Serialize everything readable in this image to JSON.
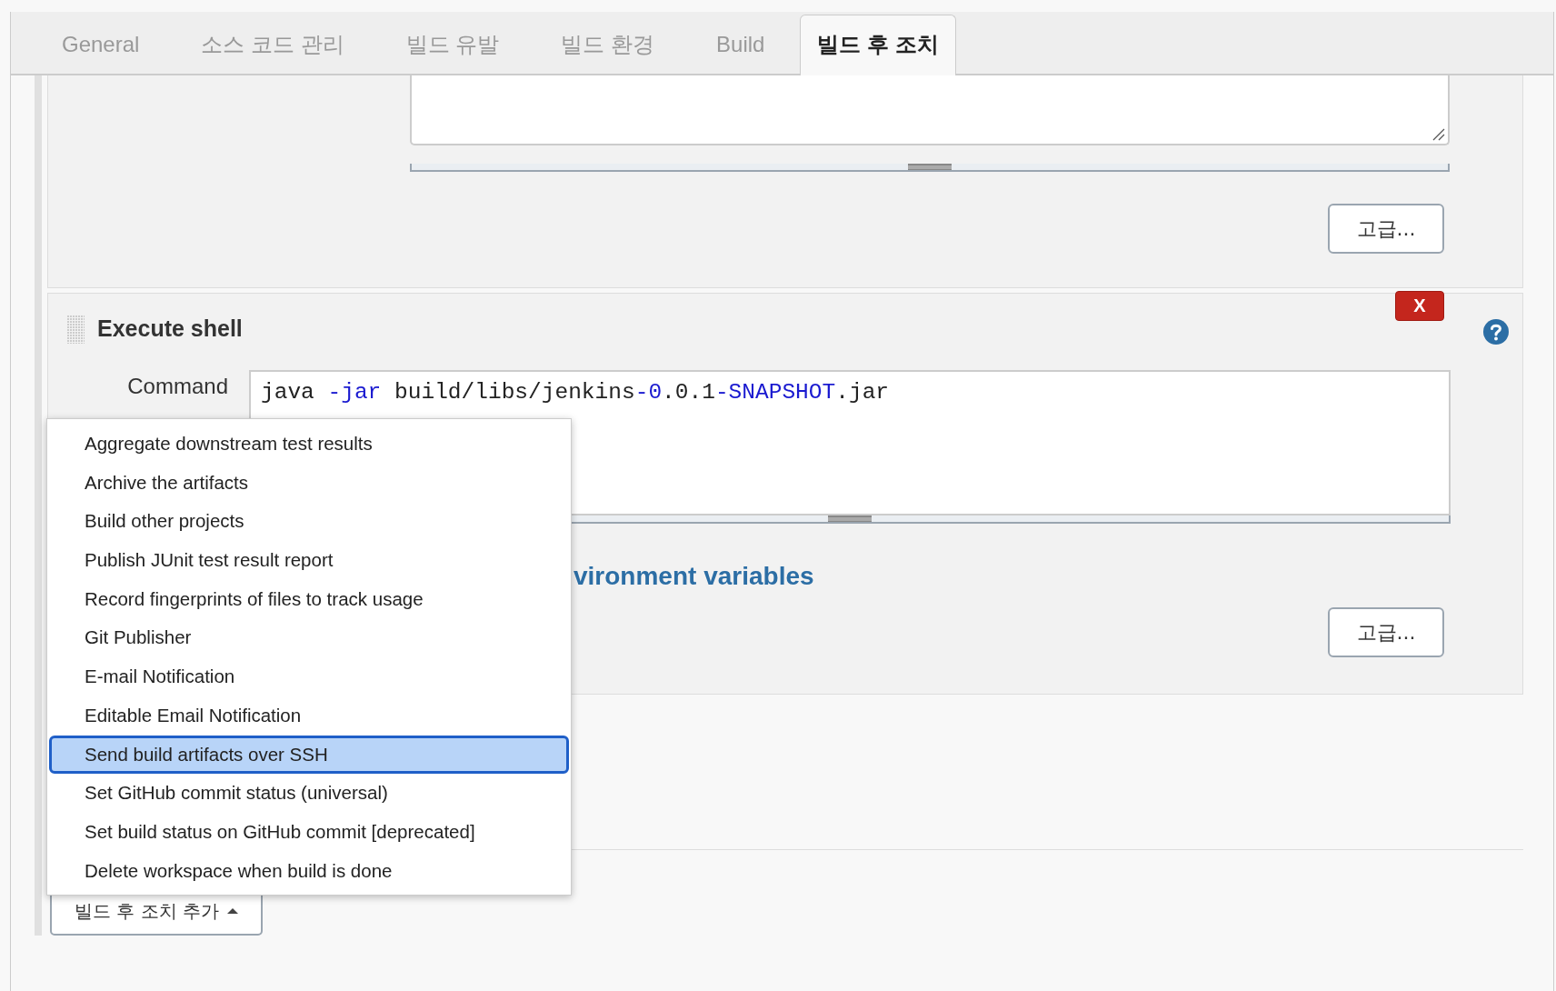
{
  "tabs": [
    {
      "label": "General",
      "selected": false
    },
    {
      "label": "소스 코드 관리",
      "selected": false
    },
    {
      "label": "빌드 유발",
      "selected": false
    },
    {
      "label": "빌드 환경",
      "selected": false
    },
    {
      "label": "Build",
      "selected": false
    },
    {
      "label": "빌드 후 조치",
      "selected": true
    }
  ],
  "previous_step": {
    "advanced_button": "고급..."
  },
  "execute_shell": {
    "title": "Execute shell",
    "delete_button": "X",
    "command": {
      "label": "Command",
      "tokens": [
        {
          "text": "java ",
          "kind": "plain"
        },
        {
          "text": "-jar",
          "kind": "highlight"
        },
        {
          "text": " build/libs/jenkins",
          "kind": "plain"
        },
        {
          "text": "-0",
          "kind": "highlight"
        },
        {
          "text": ".0.1",
          "kind": "plain"
        },
        {
          "text": "-SNAPSHOT",
          "kind": "highlight"
        },
        {
          "text": ".jar",
          "kind": "plain"
        }
      ]
    },
    "link": "vironment variables",
    "advanced_button": "고급..."
  },
  "add_button": {
    "label": "빌드 후 조치 추가",
    "expanded": true
  },
  "menu": {
    "items": [
      {
        "label": "Aggregate downstream test results",
        "selected": false
      },
      {
        "label": "Archive the artifacts",
        "selected": false
      },
      {
        "label": "Build other projects",
        "selected": false
      },
      {
        "label": "Publish JUnit test result report",
        "selected": false
      },
      {
        "label": "Record fingerprints of files to track usage",
        "selected": false
      },
      {
        "label": "Git Publisher",
        "selected": false
      },
      {
        "label": "E-mail Notification",
        "selected": false
      },
      {
        "label": "Editable Email Notification",
        "selected": false
      },
      {
        "label": "Send build artifacts over SSH",
        "selected": true
      },
      {
        "label": "Set GitHub commit status (universal)",
        "selected": false
      },
      {
        "label": "Set build status on GitHub commit [deprecated]",
        "selected": false
      },
      {
        "label": "Delete workspace when build is done",
        "selected": false
      }
    ]
  }
}
